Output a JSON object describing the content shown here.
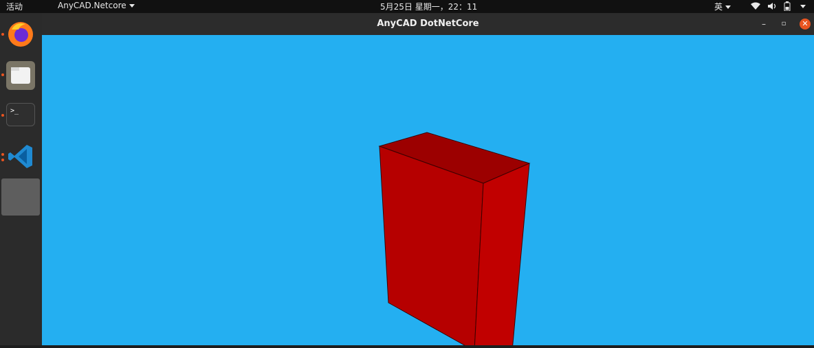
{
  "topbar": {
    "activities": "活动",
    "app_menu": "AnyCAD.Netcore",
    "clock": "5月25日 星期一，22：11",
    "input_method": "英"
  },
  "window": {
    "title": "AnyCAD DotNetCore"
  },
  "icons": {
    "dock": [
      "firefox-icon",
      "files-icon",
      "terminal-icon",
      "vscode-icon",
      "app-icon"
    ],
    "tray": [
      "wifi-icon",
      "volume-icon",
      "battery-icon",
      "system-menu-icon"
    ],
    "window_controls": [
      "minimize-icon",
      "restore-icon",
      "close-icon"
    ]
  },
  "colors": {
    "viewport_background": "#24aff1",
    "box_front": "#b60000",
    "box_top": "#9c0000",
    "box_side": "#c00000",
    "accent": "#e95420"
  }
}
